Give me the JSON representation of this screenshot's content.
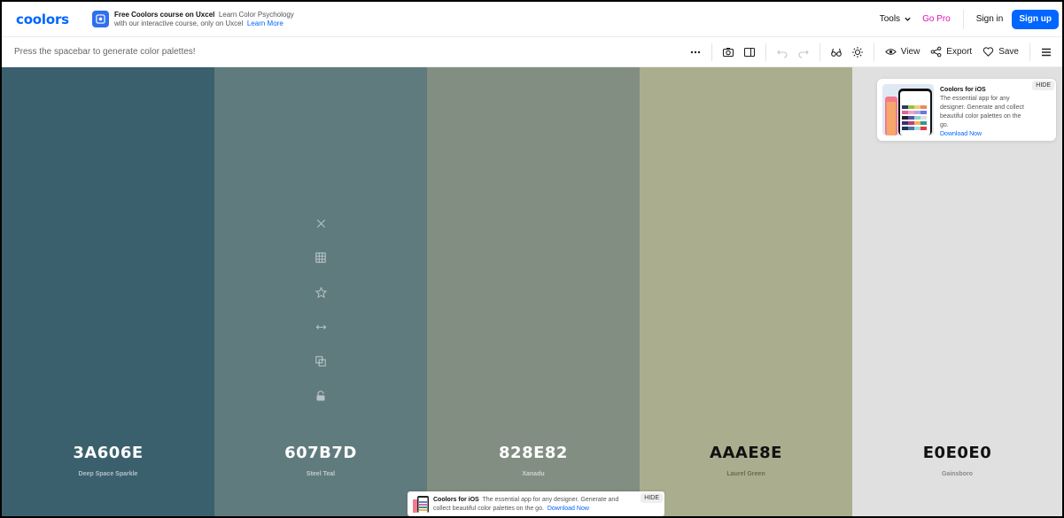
{
  "header": {
    "logo": "coolors",
    "promo": {
      "title": "Free Coolors course on Uxcel",
      "text1": "Learn Color Psychology",
      "text2": "with our interactive course, only on Uxcel",
      "link": "Learn More"
    },
    "tools_label": "Tools",
    "gopro_label": "Go Pro",
    "signin_label": "Sign in",
    "signup_label": "Sign up",
    "colors": {
      "brand": "#0066ff",
      "gopro": "#e012b8"
    }
  },
  "toolbar": {
    "hint": "Press the spacebar to generate color palettes!",
    "view_label": "View",
    "export_label": "Export",
    "save_label": "Save",
    "icons": [
      "more-icon",
      "camera-icon",
      "sidebar-icon",
      "undo-icon",
      "redo-icon",
      "glasses-icon",
      "sun-icon",
      "eye-icon",
      "share-icon",
      "heart-icon",
      "menu-icon"
    ]
  },
  "palette": [
    {
      "hex": "3A606E",
      "name": "Deep Space Sparkle",
      "color": "#3A606E"
    },
    {
      "hex": "607B7D",
      "name": "Steel Teal",
      "color": "#607B7D"
    },
    {
      "hex": "828E82",
      "name": "Xanadu",
      "color": "#828E82"
    },
    {
      "hex": "AAAE8E",
      "name": "Laurel Green",
      "color": "#AAAE8E"
    },
    {
      "hex": "E0E0E0",
      "name": "Gainsboro",
      "color": "#E0E0E0"
    }
  ],
  "column_tools": [
    "close-icon",
    "grid-icon",
    "star-icon",
    "drag-icon",
    "copy-icon",
    "lock-icon"
  ],
  "ios_card": {
    "title": "Coolors for iOS",
    "text": "The essential app for any designer. Generate and collect beautiful color palettes on the go.",
    "link": "Download Now",
    "hide": "HIDE"
  },
  "bottom_ad": {
    "title": "Coolors for iOS",
    "text": "The essential app for any designer. Generate and collect beautiful color palettes on the go.",
    "link": "Download Now",
    "hide": "HIDE"
  }
}
